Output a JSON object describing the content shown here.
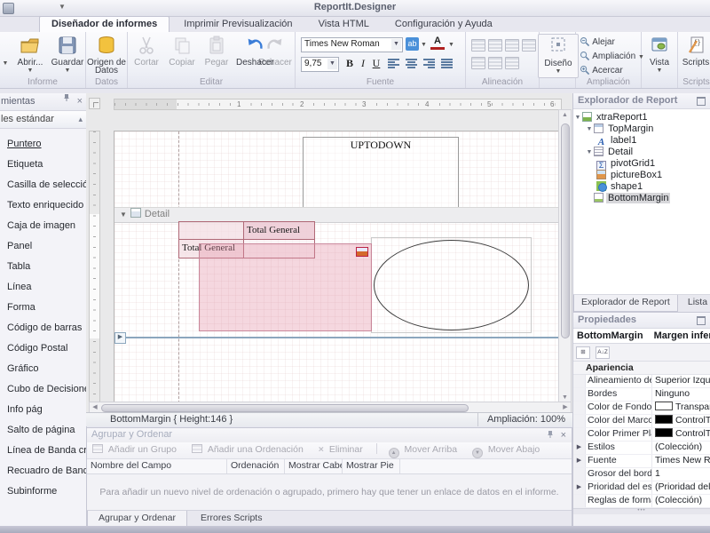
{
  "window": {
    "title": "ReportIt.Designer"
  },
  "ribbon": {
    "tabs": [
      {
        "label": "Diseñador de informes"
      },
      {
        "label": "Imprimir Previsualización"
      },
      {
        "label": "Vista HTML"
      },
      {
        "label": "Configuración y Ayuda"
      }
    ],
    "informe": {
      "caption": "Informe",
      "open": "Abrir...",
      "save": "Guardar"
    },
    "datos": {
      "caption": "Datos",
      "origin": "Origen de Datos"
    },
    "editar": {
      "caption": "Editar",
      "cut": "Cortar",
      "copy": "Copiar",
      "paste": "Pegar",
      "undo": "Deshacer",
      "redo": "Rehacer"
    },
    "fuente": {
      "caption": "Fuente",
      "font_name": "Times New Roman",
      "font_size": "9,75",
      "bold": "B",
      "italic": "I",
      "underline": "U",
      "highlight": "ab",
      "color": "A"
    },
    "alineacion": {
      "caption": "Alineación"
    },
    "diseno": {
      "label": "Diseño"
    },
    "ampliacion": {
      "caption": "Ampliación",
      "zoom_out": "Alejar",
      "zoom": "Ampliación",
      "zoom_in": "Acercar"
    },
    "vista": {
      "label": "Vista"
    },
    "scripts": {
      "caption": "Scripts",
      "label": "Scripts"
    }
  },
  "toolbox": {
    "title": "mientas",
    "section": "les estándar",
    "items": [
      "Puntero",
      "Etiqueta",
      "Casilla de selección",
      "Texto enriquecido",
      "Caja de imagen",
      "Panel",
      "Tabla",
      "Línea",
      "Forma",
      "Código de barras",
      "Código Postal",
      "Gráfico",
      "Cubo de Decisiones",
      "Info pág",
      "Salto de página",
      "Línea de Banda cr...",
      "Recuadro de Band...",
      "Subinforme"
    ]
  },
  "designer": {
    "ruler_numbers": [
      "1",
      "2",
      "3",
      "4",
      "5",
      "6"
    ],
    "label1_text": "UPTODOWN",
    "detail_band": "Detail",
    "pivot": {
      "column_header": "Total General",
      "row_header": "Total General"
    },
    "status": {
      "left": "BottomMargin { Height:146 }",
      "right": "Ampliación: 100%"
    }
  },
  "explorer": {
    "title": "Explorador de Report",
    "tree": [
      {
        "label": "xtraReport1"
      },
      {
        "label": "TopMargin"
      },
      {
        "label": "label1"
      },
      {
        "label": "Detail"
      },
      {
        "label": "pivotGrid1"
      },
      {
        "label": "pictureBox1"
      },
      {
        "label": "shape1"
      },
      {
        "label": "BottomMargin"
      }
    ],
    "tabs": [
      {
        "label": "Explorador de Report"
      },
      {
        "label": "Lista de Camp"
      }
    ]
  },
  "properties": {
    "title": "Propiedades",
    "object_name": "BottomMargin",
    "object_desc": "Margen inferior",
    "category": "Apariencia",
    "rows": [
      {
        "name": "Alineamiento de",
        "value": "Superior Izquierda"
      },
      {
        "name": "Bordes",
        "value": "Ninguno"
      },
      {
        "name": "Color de Fondo",
        "value": "Transparent",
        "swatch": "#ffffff"
      },
      {
        "name": "Color del Marco",
        "value": "ControlText",
        "swatch": "#000000"
      },
      {
        "name": "Color Primer Pla",
        "value": "ControlText",
        "swatch": "#000000"
      },
      {
        "name": "Estilos",
        "value": "(Colección)"
      },
      {
        "name": "Fuente",
        "value": "Times New Roman"
      },
      {
        "name": "Grosor del bord",
        "value": "1"
      },
      {
        "name": "Prioridad del est",
        "value": "(Prioridad del estil"
      },
      {
        "name": "Reglas de forma",
        "value": "(Colección)"
      }
    ]
  },
  "group_sort": {
    "title": "Agrupar y Ordenar",
    "toolbar": {
      "add_group": "Añadir un Grupo",
      "add_sort": "Añadir una Ordenación",
      "delete": "Eliminar",
      "move_up": "Mover Arriba",
      "move_down": "Mover Abajo"
    },
    "columns": [
      "Nombre del Campo",
      "Ordenación",
      "Mostrar Cabec...",
      "Mostrar Pie"
    ],
    "message": "Para añadir un nuevo nivel de ordenación o agrupado, primero hay que tener un enlace de datos en el informe.",
    "tabs": [
      {
        "label": "Agrupar y Ordenar"
      },
      {
        "label": "Errores Scripts"
      }
    ]
  },
  "colors": {
    "selection_pink": "#e28ca2",
    "pivot_border": "#b06a78",
    "band_line": "#8ca6bd",
    "accent_blue": "#3b7dd8"
  }
}
